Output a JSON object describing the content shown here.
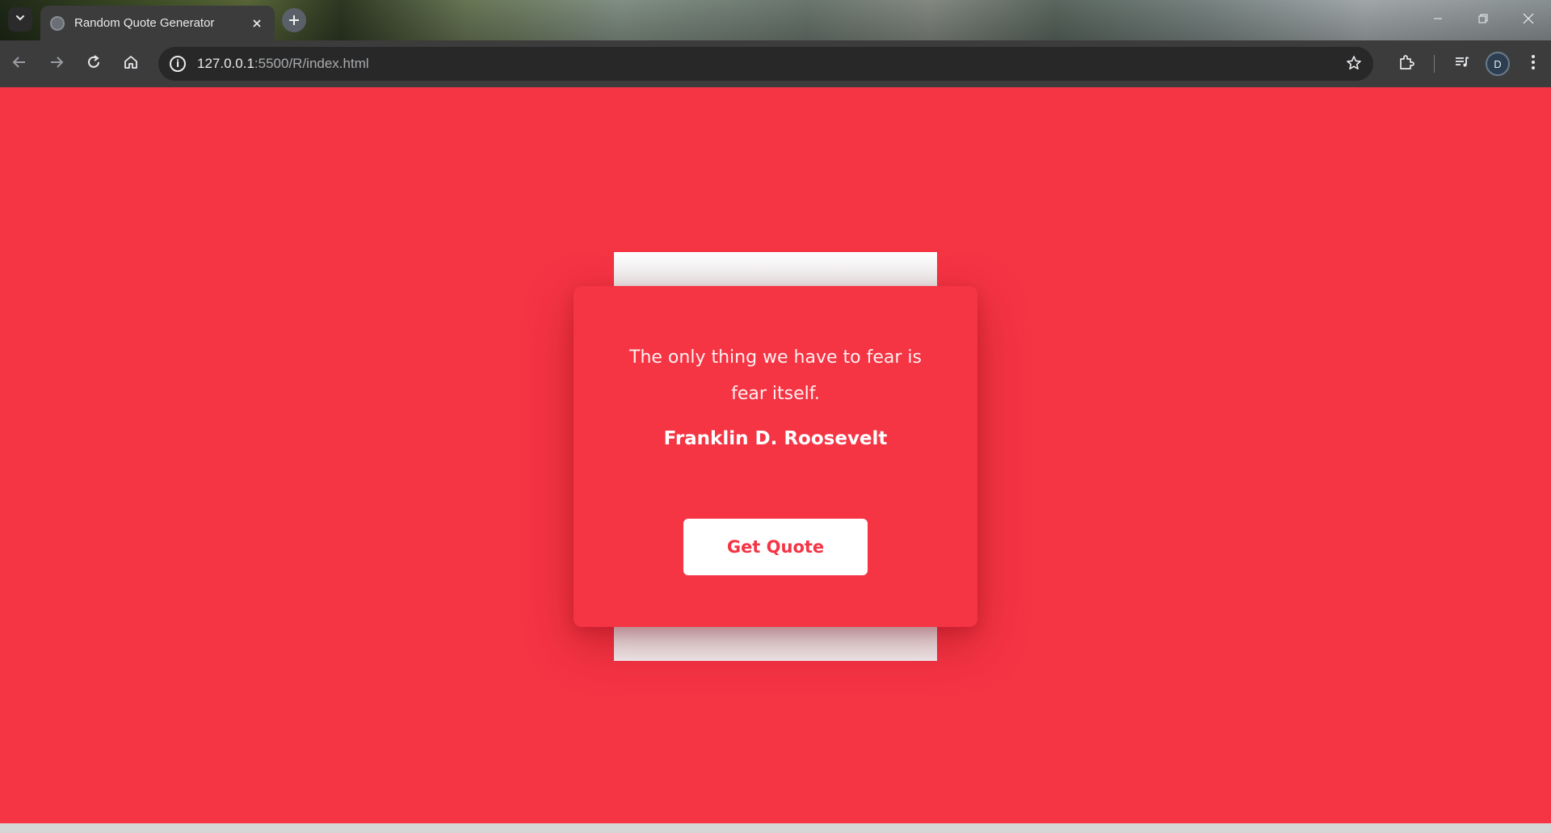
{
  "browser": {
    "tab_title": "Random Quote Generator",
    "url_host": "127.0.0.1",
    "url_rest": ":5500/R/index.html",
    "profile_initial": "D"
  },
  "app": {
    "quote_text": "The only thing we have to fear is fear itself.",
    "author": "Franklin D. Roosevelt",
    "button_label": "Get Quote"
  },
  "colors": {
    "accent": "#f53444",
    "card_text": "#ffffff",
    "button_bg": "#ffffff"
  },
  "icons": [
    "tab-list-icon",
    "globe-icon",
    "close-icon",
    "plus-icon",
    "minimize-icon",
    "restore-icon",
    "back-arrow-icon",
    "forward-arrow-icon",
    "reload-icon",
    "home-icon",
    "info-icon",
    "star-icon",
    "extensions-icon",
    "media-queue-icon",
    "more-vert-icon"
  ]
}
